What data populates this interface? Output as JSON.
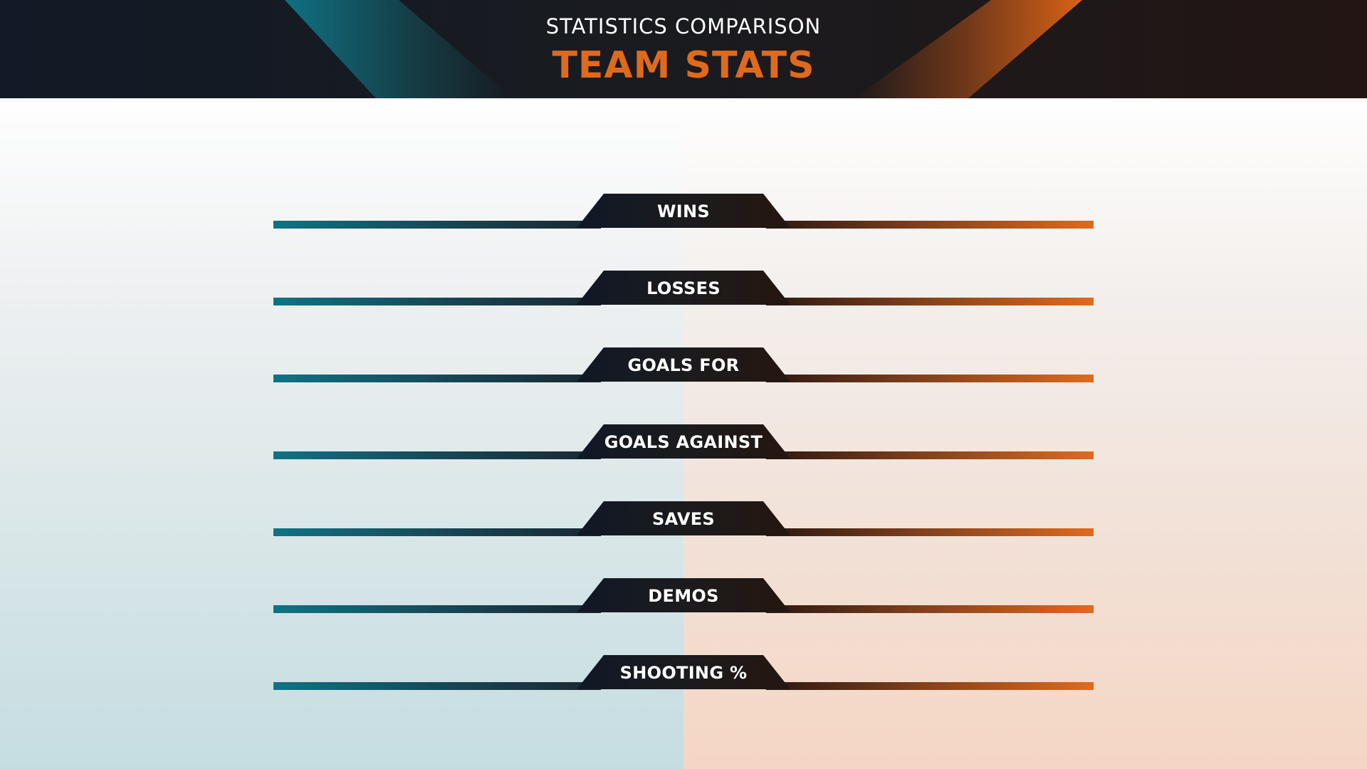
{
  "header": {
    "subtitle": "STATISTICS COMPARISON",
    "title": "TEAM STATS"
  },
  "stats": [
    {
      "label": "WINS"
    },
    {
      "label": "LOSSES"
    },
    {
      "label": "GOALS FOR"
    },
    {
      "label": "GOALS AGAINST"
    },
    {
      "label": "SAVES"
    },
    {
      "label": "DEMOS"
    },
    {
      "label": "SHOOTING %"
    }
  ],
  "colors": {
    "accent_teal": "#0e7384",
    "accent_orange": "#e06a1c",
    "header_dark": "#1a1b1f"
  }
}
